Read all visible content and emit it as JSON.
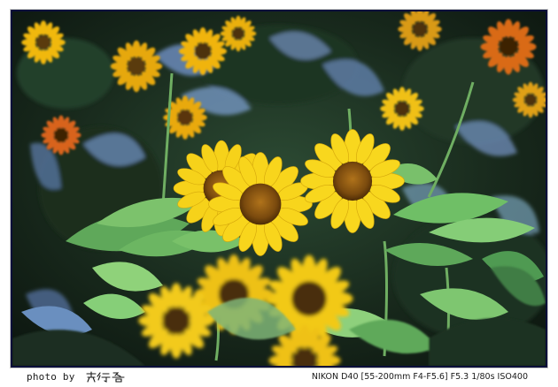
{
  "caption": {
    "left": "photo by",
    "signature": "老行者",
    "right": "NIKON D40 [55-200mm F4-F5.6] F5.3 1/80s ISO400"
  },
  "photo": {
    "subject": "sunflowers",
    "colors": {
      "petal": "#f6d21a",
      "center": "#8a5a12",
      "leaf_light": "#8fd27a",
      "leaf_dark": "#1d3a22",
      "shadow_leaf": "#5f7fb0",
      "border": "#0a0f3a"
    }
  }
}
